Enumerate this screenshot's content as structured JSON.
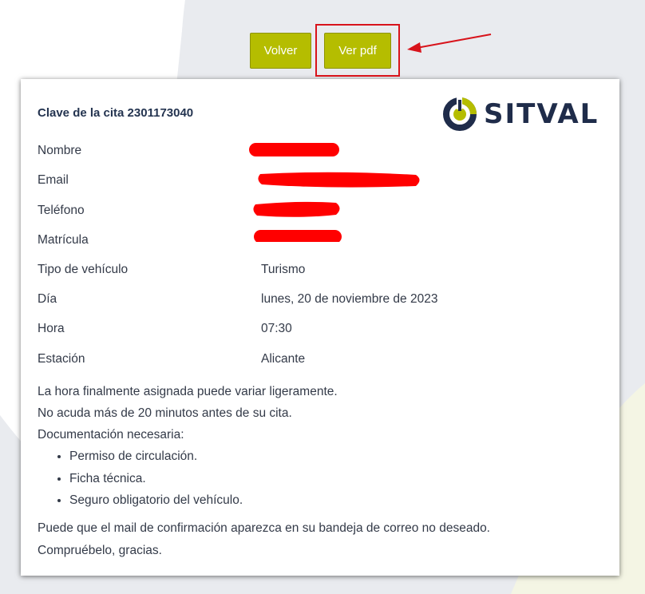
{
  "buttons": {
    "back_label": "Volver",
    "pdf_label": "Ver pdf"
  },
  "card": {
    "title": "Clave de la cita 2301173040",
    "logo_text": "SITVAL",
    "fields": [
      {
        "label": "Nombre",
        "value": ""
      },
      {
        "label": "Email",
        "value": ""
      },
      {
        "label": "Teléfono",
        "value": ""
      },
      {
        "label": "Matrícula",
        "value": ""
      },
      {
        "label": "Tipo de vehículo",
        "value": "Turismo"
      },
      {
        "label": "Día",
        "value": "lunes, 20 de noviembre de 2023"
      },
      {
        "label": "Hora",
        "value": "07:30"
      },
      {
        "label": "Estación",
        "value": "Alicante"
      }
    ],
    "notes": [
      "La hora finalmente asignada puede variar ligeramente.",
      "No acuda más de 20 minutos antes de su cita.",
      "Documentación necesaria:"
    ],
    "documents": [
      "Permiso de circulación.",
      "Ficha técnica.",
      "Seguro obligatorio del vehículo."
    ],
    "footer": [
      "Puede que el mail de confirmación aparezca en su bandeja de correo no deseado.",
      "Compruébelo, gracias."
    ]
  },
  "colors": {
    "button_bg": "#b5bd00",
    "highlight_red": "#d8131b",
    "logo_navy": "#1f2c4a",
    "logo_green": "#b5bd00",
    "background_shape": "#e8eaee"
  }
}
